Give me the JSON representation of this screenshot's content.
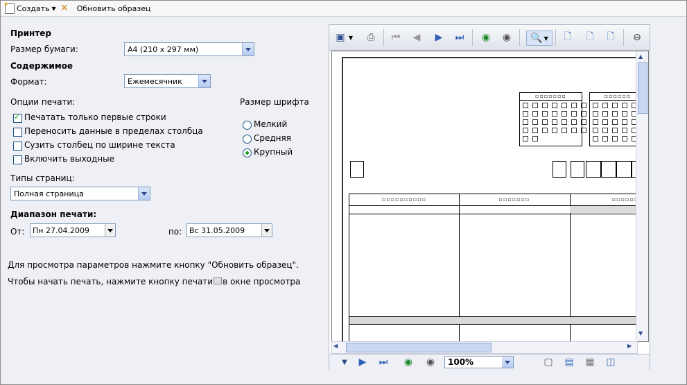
{
  "toolbar": {
    "create_label": "Создать",
    "refresh_label": "Обновить образец"
  },
  "settings": {
    "printer_heading": "Принтер",
    "paper_size_label": "Размер бумаги:",
    "paper_size_value": "A4 (210 x 297 мм)",
    "content_heading": "Содержимое",
    "format_label": "Формат:",
    "format_value": "Ежемесячник",
    "print_options_label": "Опции печати:",
    "options": [
      {
        "label": "Печатать только первые строки",
        "checked": true
      },
      {
        "label": "Переносить данные в пределах столбца",
        "checked": false
      },
      {
        "label": "Сузить столбец по ширине текста",
        "checked": false
      },
      {
        "label": "Включить выходные",
        "checked": false
      }
    ],
    "font_size_label": "Размер шрифта",
    "font_sizes": [
      {
        "label": "Мелкий",
        "selected": false
      },
      {
        "label": "Средняя",
        "selected": false
      },
      {
        "label": "Крупный",
        "selected": true
      }
    ],
    "page_types_label": "Типы страниц:",
    "page_type_value": "Полная страница",
    "print_range_heading": "Диапазон печати:",
    "from_label": "От:",
    "from_value": "Пн 27.04.2009",
    "to_label": "по:",
    "to_value": "Вс 31.05.2009",
    "hint1": "Для просмотра параметров нажмите кнопку \"Обновить образец\".",
    "hint2": "Чтобы начать печать, нажмите кнопку печати",
    "hint2_tail": "в окне просмотра"
  },
  "preview": {
    "zoom": "100%"
  }
}
